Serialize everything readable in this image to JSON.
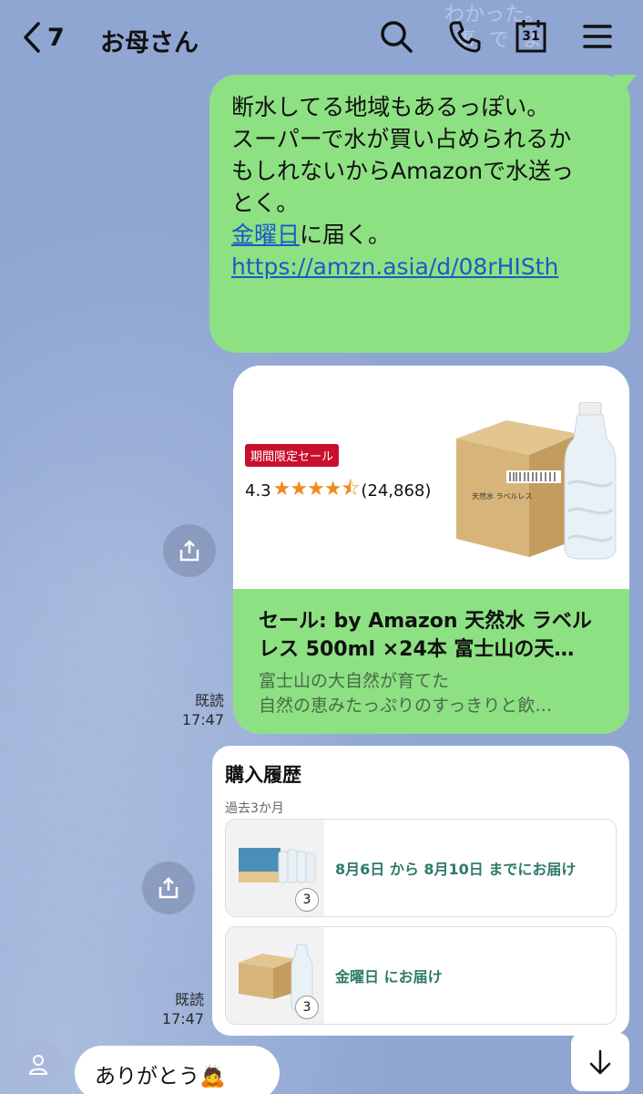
{
  "header": {
    "back_count": "7",
    "title": "お母さん",
    "calendar_day": "31",
    "ghost_line1": "わかった。",
    "ghost_line2": "事 で よ"
  },
  "msg1": {
    "lines": [
      "断水してる地域もあるっぽい。",
      "",
      "スーパーで水が買い占められるか",
      "もしれないからAmazonで水送っ",
      "とく。",
      ""
    ],
    "link_day": "金曜日",
    "after_link": "に届く。",
    "url": "https://amzn.asia/d/08rHISth"
  },
  "card": {
    "badge": "期間限定セール",
    "rating": "4.3",
    "stars": "★★★★⯪",
    "reviews": "(24,868)",
    "title_line1": "セール: by Amazon 天然水 ラベル",
    "title_line2": "レス 500ml ×24本 富士山の天…",
    "desc_line1": "富士山の大自然が育てた",
    "desc_line2": "自然の恵みたっぷりのすっきりと飲…",
    "box_label": "天然水 ラベルレス"
  },
  "read1": {
    "label": "既読",
    "time": "17:47"
  },
  "history": {
    "title": "購入履歴",
    "sub": "過去3か月",
    "items": [
      {
        "qty": "3",
        "text": "8月6日 から 8月10日 までにお届け"
      },
      {
        "qty": "3",
        "text": "金曜日 にお届け"
      }
    ]
  },
  "read2": {
    "label": "既読",
    "time": "17:47"
  },
  "incoming": {
    "text": "ありがとう",
    "emoji": "🙇"
  }
}
